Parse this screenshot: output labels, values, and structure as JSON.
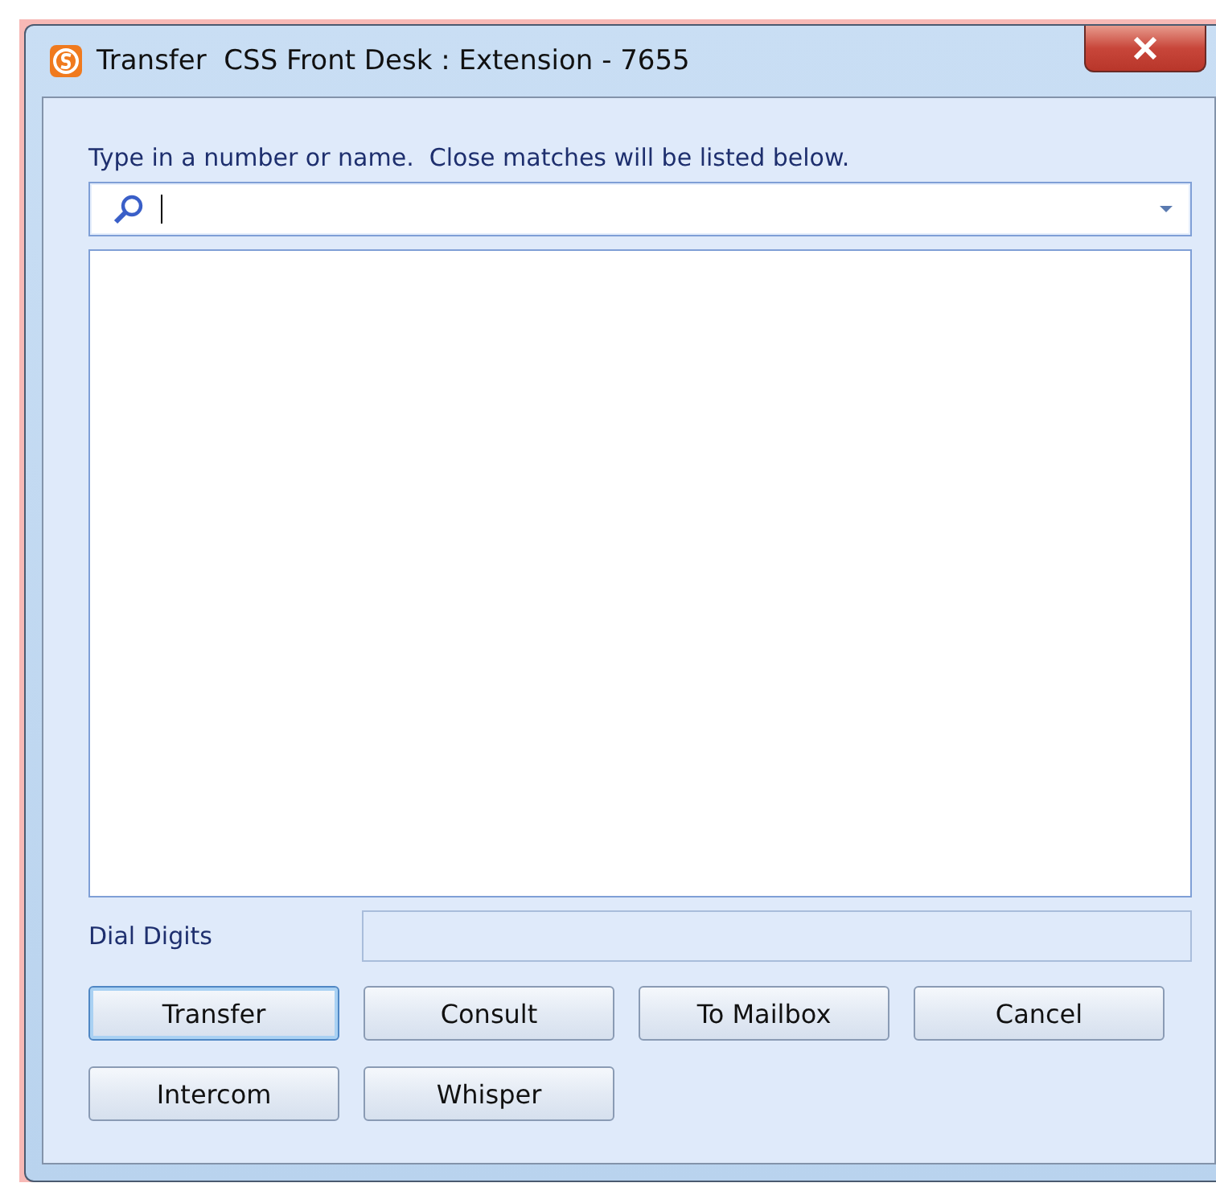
{
  "window": {
    "title": "Transfer  CSS Front Desk : Extension - 7655"
  },
  "prompt": "Type in a number or name.  Close matches will be listed below.",
  "search": {
    "focused": true
  },
  "dial_digits": {
    "label": "Dial Digits"
  },
  "buttons": [
    {
      "label": "Transfer",
      "default": true
    },
    {
      "label": "Consult",
      "default": false
    },
    {
      "label": "To Mailbox",
      "default": false
    },
    {
      "label": "Cancel",
      "default": false
    },
    {
      "label": "Intercom",
      "default": false
    },
    {
      "label": "Whisper",
      "default": false
    }
  ]
}
